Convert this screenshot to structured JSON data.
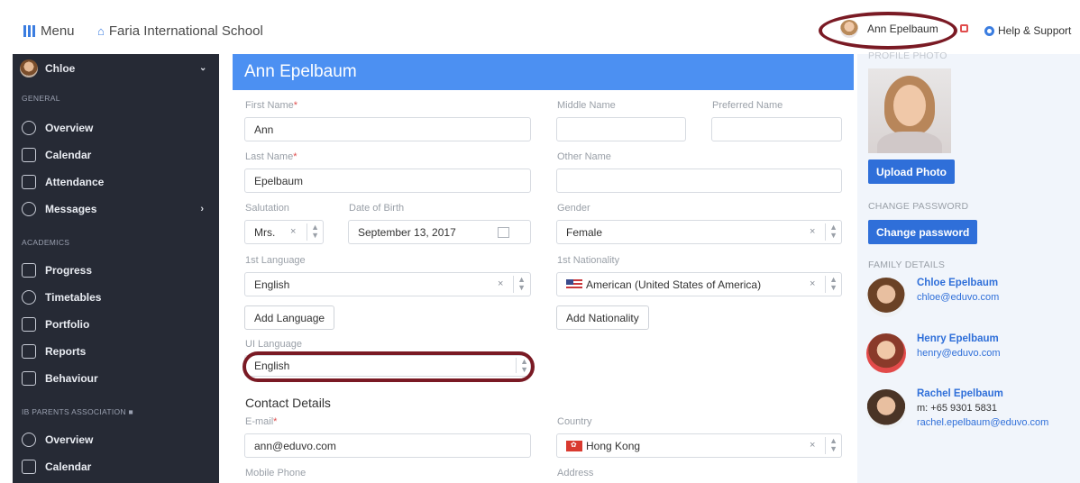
{
  "topbar": {
    "menu_label": "Menu",
    "school_name": "Faria International School",
    "user_name": "Ann Epelbaum",
    "help_label": "Help & Support"
  },
  "sidebar": {
    "user": "Chloe",
    "sections": [
      {
        "title": "GENERAL",
        "items": [
          {
            "label": "Overview",
            "icon": "dashboard-icon"
          },
          {
            "label": "Calendar",
            "icon": "calendar-icon"
          },
          {
            "label": "Attendance",
            "icon": "attendance-icon"
          },
          {
            "label": "Messages",
            "icon": "messages-icon"
          }
        ]
      },
      {
        "title": "ACADEMICS",
        "items": [
          {
            "label": "Progress",
            "icon": "progress-icon"
          },
          {
            "label": "Timetables",
            "icon": "clock-icon"
          },
          {
            "label": "Portfolio",
            "icon": "portfolio-icon"
          },
          {
            "label": "Reports",
            "icon": "reports-icon"
          },
          {
            "label": "Behaviour",
            "icon": "flag-icon"
          }
        ]
      },
      {
        "title": "IB PARENTS ASSOCIATION",
        "items": [
          {
            "label": "Overview",
            "icon": "dashboard-icon"
          },
          {
            "label": "Calendar",
            "icon": "calendar-icon"
          }
        ]
      }
    ]
  },
  "main": {
    "title": "Ann Epelbaum",
    "fields": {
      "first_name": {
        "label": "First Name",
        "value": "Ann"
      },
      "middle_name": {
        "label": "Middle Name",
        "value": ""
      },
      "preferred_name": {
        "label": "Preferred Name",
        "value": ""
      },
      "last_name": {
        "label": "Last Name",
        "value": "Epelbaum"
      },
      "other_name": {
        "label": "Other Name",
        "value": ""
      },
      "salutation": {
        "label": "Salutation",
        "value": "Mrs."
      },
      "dob": {
        "label": "Date of Birth",
        "value": "September 13, 2017"
      },
      "gender": {
        "label": "Gender",
        "value": "Female"
      },
      "language": {
        "label": "1st Language",
        "value": "English"
      },
      "nationality": {
        "label": "1st Nationality",
        "value": "American (United States of America)"
      },
      "ui_language": {
        "label": "UI Language",
        "value": "English"
      },
      "email": {
        "label": "E-mail",
        "value": "ann@eduvo.com"
      },
      "country": {
        "label": "Country",
        "value": "Hong Kong"
      },
      "mobile": {
        "label": "Mobile Phone"
      },
      "address": {
        "label": "Address"
      }
    },
    "add_language": "Add Language",
    "add_nationality": "Add Nationality",
    "contact_details": "Contact Details",
    "required_mark": "*",
    "clear_glyph": "×"
  },
  "right": {
    "photo_label": "PROFILE PHOTO",
    "upload": "Upload Photo",
    "change_password_label": "CHANGE PASSWORD",
    "change_password_btn": "Change password",
    "family_label": "FAMILY DETAILS",
    "family": [
      {
        "name": "Chloe Epelbaum",
        "line1": "chloe@eduvo.com"
      },
      {
        "name": "Henry Epelbaum",
        "line1": "henry@eduvo.com"
      },
      {
        "name": "Rachel Epelbaum",
        "line1": "m: +65 9301 5831",
        "line2": "rachel.epelbaum@eduvo.com"
      }
    ]
  },
  "colors": {
    "accent": "#4c90f2",
    "sidebar": "#262a35",
    "highlight_ring": "#7a1a24"
  }
}
